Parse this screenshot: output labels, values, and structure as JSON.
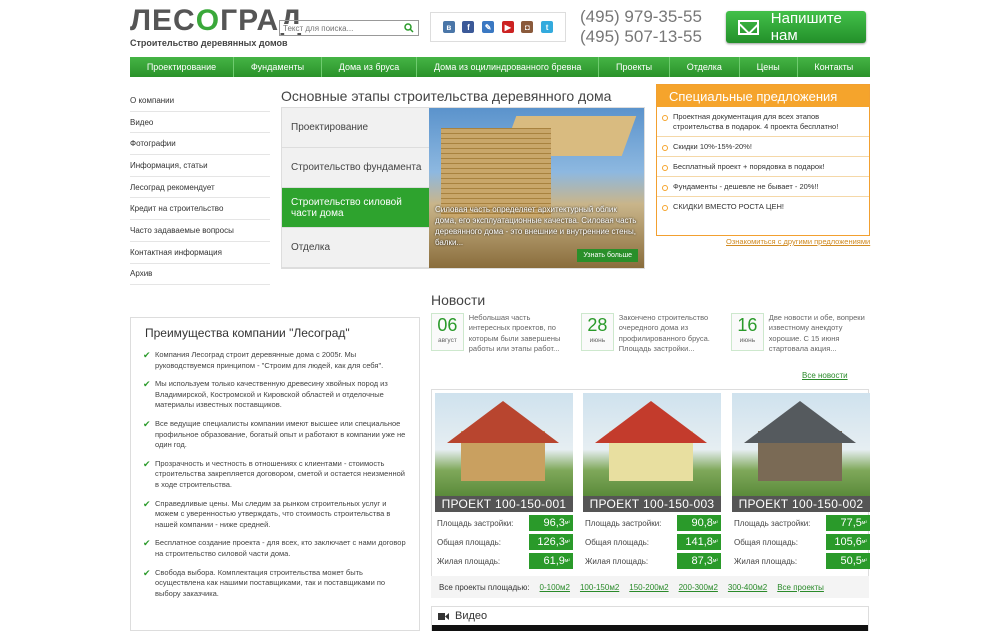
{
  "header": {
    "logo_title": "ЛЕСОГРАД",
    "logo_sub": "Строительство деревянных домов",
    "search_placeholder": "Текст для поиска...",
    "phones": [
      "(495) 979-35-55",
      "(495) 507-13-55"
    ],
    "write_btn": "Напишите нам",
    "social": [
      {
        "name": "vk-icon",
        "color": "#4a76a8",
        "glyph": "в"
      },
      {
        "name": "facebook-icon",
        "color": "#3b5998",
        "glyph": "f"
      },
      {
        "name": "livejournal-icon",
        "color": "#3a78c2",
        "glyph": "✎"
      },
      {
        "name": "youtube-icon",
        "color": "#cc2222",
        "glyph": "▶"
      },
      {
        "name": "instagram-icon",
        "color": "#8a5a3c",
        "glyph": "◘"
      },
      {
        "name": "twitter-icon",
        "color": "#33aadd",
        "glyph": "t"
      }
    ]
  },
  "menu": [
    "Проектирование",
    "Фундаменты",
    "Дома из бруса",
    "Дома из оцилиндрованного бревна",
    "Проекты",
    "Отделка",
    "Цены",
    "Контакты"
  ],
  "sidenav": [
    "О компании",
    "Видео",
    "Фотографии",
    "Информация, статьи",
    "Лесоград рекомендует",
    "Кредит на строительство",
    "Часто задаваемые вопросы",
    "Контактная информация",
    "Архив"
  ],
  "stages": {
    "title": "Основные этапы строительства деревянного дома",
    "items": [
      "Проектирование",
      "Строительство фундамента",
      "Строительство силовой части дома",
      "Отделка"
    ],
    "active": 2,
    "text": "Силовая часть определяет архитектурный облик дома, его эксплуатационные качества. Силовая часть деревянного дома - это внешние и внутренние стены, балки...",
    "more": "Узнать больше"
  },
  "special": {
    "title": "Специальные предложения",
    "items": [
      "Проектная документация для всех этапов строительства в подарок. 4 проекта бесплатно!",
      "Скидки 10%-15%-20%!",
      "Бесплатный проект + порядовка в подарок!",
      "Фундаменты - дешевле не бывает - 20%!!",
      "СКИДКИ ВМЕСТО РОСТА ЦЕН!"
    ],
    "link": "Ознакомиться с другими предложениями"
  },
  "advantages": {
    "title": "Преимущества компании \"Лесоград\"",
    "items": [
      "Компания Лесоград строит деревянные дома с 2005г. Мы руководствуемся принципом - \"Строим для людей, как для себя\".",
      "Мы используем только качественную древесину хвойных пород из Владимирской, Костромской и Кировской областей и отделочные материалы известных поставщиков.",
      "Все ведущие специалисты компании имеют высшее или специальное профильное образование, богатый опыт и работают в компании уже не один год.",
      "Прозрачность и честность в отношениях с клиентами - стоимость строительства закрепляется договором, сметой и остается неизменной в ходе строительства.",
      "Справедливые цены. Мы следим за рынком строительных услуг и можем с уверенностью утверждать, что стоимость строительства в нашей компании - ниже средней.",
      "Бесплатное создание проекта - для всех, кто заключает с нами договор на строительство силовой части дома.",
      "Свобода выбора. Комплектация строительства может быть осуществлена как нашими поставщиками, так и поставщиками по выбору заказчика."
    ]
  },
  "news": {
    "title": "Новости",
    "items": [
      {
        "day": "06",
        "month": "август",
        "text": "Небольшая часть интересных проектов, по которым были завершены работы или этапы работ..."
      },
      {
        "day": "28",
        "month": "июнь",
        "text": "Закончено строительство очередного дома из профилированного бруса. Площадь застройки..."
      },
      {
        "day": "16",
        "month": "июнь",
        "text": "Две новости и обе, вопреки известному анекдоту хорошие. С 15 июня стартовала акция..."
      }
    ],
    "all": "Все новости"
  },
  "projects": {
    "labels": [
      "Площадь застройки:",
      "Общая площадь:",
      "Жилая площадь:"
    ],
    "unit": "м²",
    "items": [
      {
        "name": "ПРОЕКТ 100-150-001",
        "values": [
          "96,3",
          "126,3",
          "61,9"
        ],
        "roof": "#b8452f",
        "wall": "#c9a060"
      },
      {
        "name": "ПРОЕКТ 100-150-003",
        "values": [
          "90,8",
          "141,8",
          "87,3"
        ],
        "roof": "#c33b2c",
        "wall": "#e8dfa0"
      },
      {
        "name": "ПРОЕКТ 100-150-002",
        "values": [
          "77,5",
          "105,6",
          "50,5"
        ],
        "roof": "#555a5e",
        "wall": "#7a6a55"
      }
    ]
  },
  "areas": {
    "label": "Все проекты площадью:",
    "links": [
      "0-100м2",
      "100-150м2",
      "150-200м2",
      "200-300м2",
      "300-400м2",
      "Все проекты"
    ]
  },
  "video": {
    "title": "Видео"
  }
}
